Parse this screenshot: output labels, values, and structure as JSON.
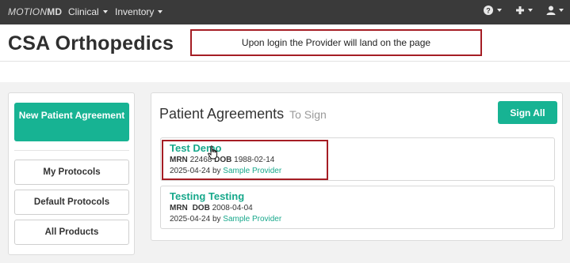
{
  "navbar": {
    "brand_part1": "MOTION",
    "brand_part2": "MD",
    "menu": [
      {
        "label": "Clinical"
      },
      {
        "label": "Inventory"
      }
    ],
    "icons": [
      "help-icon",
      "plus-icon",
      "user-icon"
    ]
  },
  "header": {
    "title": "CSA Orthopedics"
  },
  "callout": {
    "text": "Upon login the Provider will land on the page"
  },
  "sidebar": {
    "new_agreement": "New Patient Agreement",
    "items": [
      {
        "label": "My Protocols"
      },
      {
        "label": "Default Protocols"
      },
      {
        "label": "All Products"
      }
    ]
  },
  "panel": {
    "title": "Patient Agreements",
    "subtitle": "To Sign",
    "sign_all": "Sign All",
    "agreements": [
      {
        "name": "Test Demo",
        "mrn_label": "MRN",
        "mrn": "22468",
        "dob_label": "DOB",
        "dob": "1988-02-14",
        "date": "2025-04-24",
        "by": "by",
        "provider": "Sample Provider"
      },
      {
        "name": "Testing Testing",
        "mrn_label": "MRN",
        "mrn": "",
        "dob_label": "DOB",
        "dob": "2008-04-04",
        "date": "2025-04-24",
        "by": "by",
        "provider": "Sample Provider"
      }
    ]
  },
  "colors": {
    "navbar_bg": "#3a3a3a",
    "accent": "#17b393",
    "callout_border": "#a51d24"
  }
}
